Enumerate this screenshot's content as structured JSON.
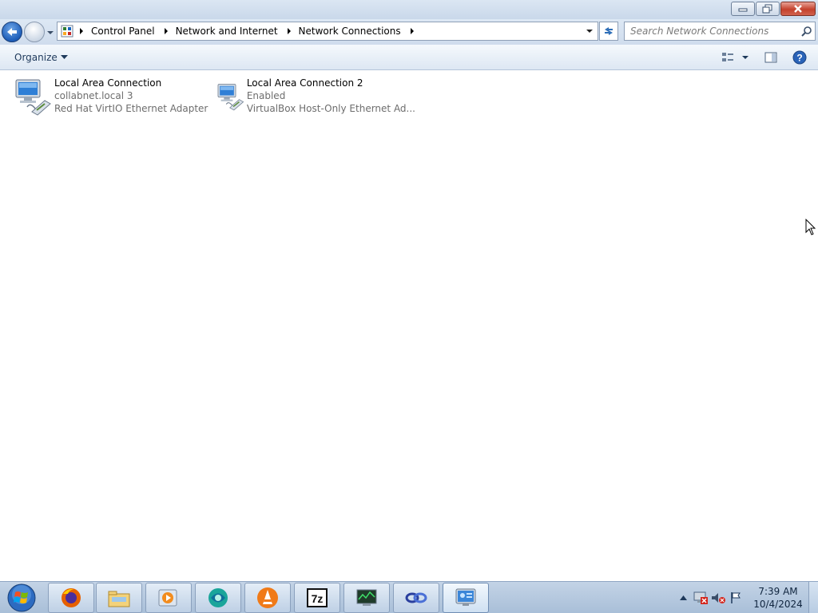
{
  "window": {
    "caption": {
      "minimize_icon": "minimize-icon",
      "maximize_icon": "restore-icon",
      "close_icon": "close-icon"
    }
  },
  "address": {
    "breadcrumbs": [
      "Control Panel",
      "Network and Internet",
      "Network Connections"
    ],
    "search_placeholder": "Search Network Connections"
  },
  "toolbar": {
    "organize_label": "Organize",
    "icons": [
      "change-view-icon",
      "preview-pane-icon",
      "help-icon"
    ]
  },
  "connections": [
    {
      "name": "Local Area Connection",
      "status": "collabnet.local  3",
      "device": "Red Hat VirtIO Ethernet Adapter"
    },
    {
      "name": "Local Area Connection 2",
      "status": "Enabled",
      "device": "VirtualBox Host-Only Ethernet Ad..."
    }
  ],
  "taskbar": {
    "pinned": [
      "firefox-icon",
      "explorer-icon",
      "media-player-icon",
      "browser-icon",
      "vlc-icon",
      "7zip-icon",
      "task-manager-icon",
      "app-icon",
      "network-control-panel-icon"
    ],
    "clock_time": "7:39 AM",
    "clock_date": "10/4/2024"
  },
  "colors": {
    "accent": "#1d5db8",
    "close_red": "#c4412c",
    "secondary_text": "#6d6d6d"
  }
}
